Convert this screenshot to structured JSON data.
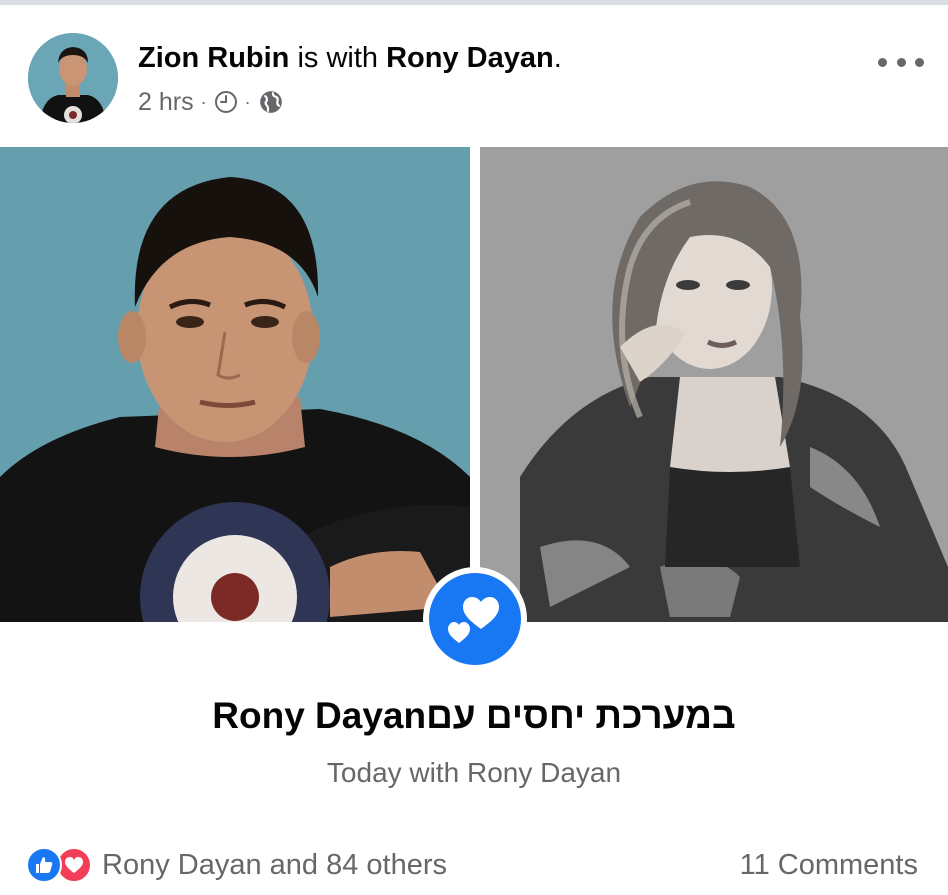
{
  "post": {
    "author": "Zion Rubin",
    "with_text": "is with",
    "tagged": "Rony Dayan",
    "period": ".",
    "time": "2 hrs",
    "separator": "·",
    "clock_icon": "clock-icon",
    "privacy_icon": "globe-icon",
    "more_icon": "more-dots-icon"
  },
  "photos": {
    "left_subject": "Zion Rubin",
    "right_subject": "Rony Dayan"
  },
  "relationship": {
    "title": "במערכת יחסים עםRony Dayan",
    "subtitle": "Today with Rony Dayan",
    "badge_icon": "hearts-icon"
  },
  "footer": {
    "reactions_text": "Rony Dayan and 84 others",
    "comments_text": "11 Comments",
    "reaction_icons": [
      "like-icon",
      "love-icon"
    ]
  },
  "colors": {
    "accent": "#1877f2",
    "love": "#f33e58",
    "secondary_text": "#65676b"
  }
}
